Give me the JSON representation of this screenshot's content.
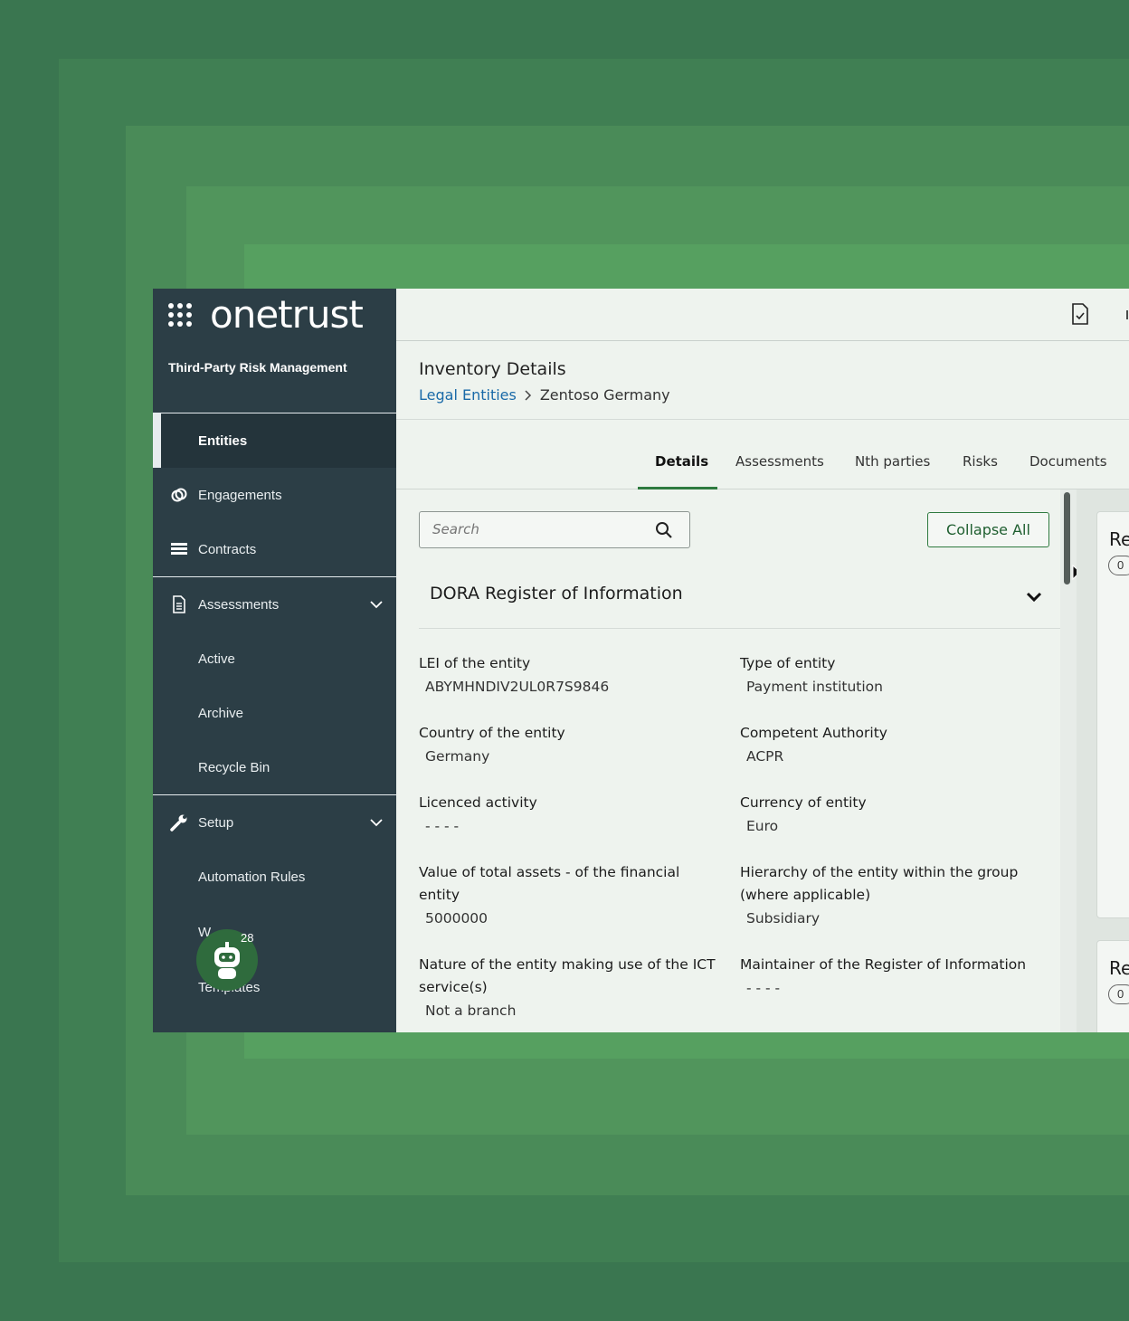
{
  "brand": {
    "logo": "onetrust",
    "module": "Third-Party Risk Management"
  },
  "sidebar": {
    "items": [
      {
        "label": "Entities",
        "active": true
      },
      {
        "label": "Engagements",
        "icon": "link-icon"
      },
      {
        "label": "Contracts",
        "icon": "list-icon"
      },
      {
        "label": "Assessments",
        "icon": "document-icon",
        "expandable": true
      },
      {
        "label": "Active"
      },
      {
        "label": "Archive"
      },
      {
        "label": "Recycle Bin"
      },
      {
        "label": "Setup",
        "icon": "wrench-icon",
        "expandable": true
      },
      {
        "label": "Automation Rules"
      }
    ],
    "partial_item_top": "W",
    "partial_item_bottom": "Templates",
    "bot_badge": "28"
  },
  "header": {
    "title": "Inventory Details",
    "breadcrumb_link": "Legal Entities",
    "breadcrumb_current": "Zentoso Germany"
  },
  "tabs": [
    "Details",
    "Assessments",
    "Nth parties",
    "Risks",
    "Documents"
  ],
  "search": {
    "placeholder": "Search"
  },
  "collapse_label": "Collapse All",
  "section": {
    "title": "DORA Register of Information",
    "fields": [
      {
        "label": "LEI of the entity",
        "value": "ABYMHNDIV2UL0R7S9846"
      },
      {
        "label": "Type of entity",
        "value": "Payment institution"
      },
      {
        "label": "Country of the entity",
        "value": "Germany"
      },
      {
        "label": "Competent Authority",
        "value": "ACPR"
      },
      {
        "label": "Licenced activity",
        "value": "- - - -"
      },
      {
        "label": "Currency of entity",
        "value": "Euro"
      },
      {
        "label": "Value of total assets - of the financial entity",
        "value": "5000000"
      },
      {
        "label": "Hierarchy of the entity within the group (where applicable)",
        "value": "Subsidiary"
      },
      {
        "label": "Nature of the entity making use of the ICT service(s)",
        "value": "Not a branch"
      },
      {
        "label": "Maintainer of the Register of Information",
        "value": "- - - -"
      }
    ]
  },
  "right_cards": [
    {
      "title": "Re",
      "pill": "0"
    },
    {
      "title": "Re",
      "pill": "0"
    }
  ],
  "colors": {
    "sidebar": "#2c3e46",
    "accent": "#2e7a3f",
    "link": "#1a6aa8"
  }
}
